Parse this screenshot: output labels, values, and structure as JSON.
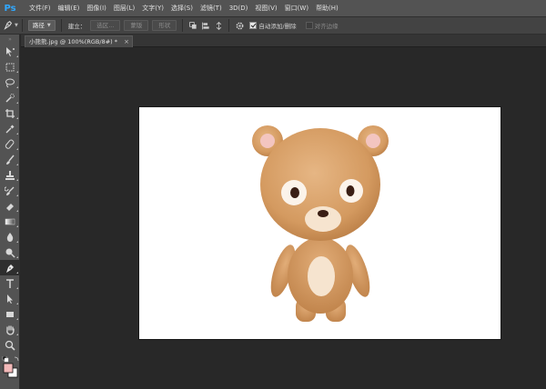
{
  "app": {
    "logo": "Ps"
  },
  "menu": [
    "文件(F)",
    "编辑(E)",
    "图像(I)",
    "图层(L)",
    "文字(Y)",
    "选择(S)",
    "滤镜(T)",
    "3D(D)",
    "视图(V)",
    "窗口(W)",
    "帮助(H)"
  ],
  "options_bar": {
    "tool_mode": "路径",
    "make_label": "建立：",
    "selection_button": "选区...",
    "mask_button": "蒙版",
    "shape_button": "形状",
    "auto_add_delete_label": "自动添加/删除",
    "auto_add_delete_checked": true,
    "align_edges_label": "对齐边缘",
    "align_edges_checked": false
  },
  "document": {
    "tab_title": "小熊熊.jpg @ 100%(RGB/8#) *",
    "close_symbol": "×"
  },
  "tools": [
    "move-tool",
    "marquee-tool",
    "lasso-tool",
    "quick-selection-tool",
    "crop-tool",
    "eyedropper-tool",
    "spot-healing-tool",
    "brush-tool",
    "clone-stamp-tool",
    "history-brush-tool",
    "eraser-tool",
    "gradient-tool",
    "blur-tool",
    "dodge-tool",
    "pen-tool",
    "type-tool",
    "path-selection-tool",
    "rectangle-tool",
    "hand-tool",
    "zoom-tool"
  ],
  "active_tool": "pen-tool",
  "colors": {
    "foreground": "#f2b9b9",
    "background": "#ffffff",
    "accent": "#31a8ff",
    "bear_fur": "#d9a06a",
    "bear_light": "#f4e2cc"
  }
}
